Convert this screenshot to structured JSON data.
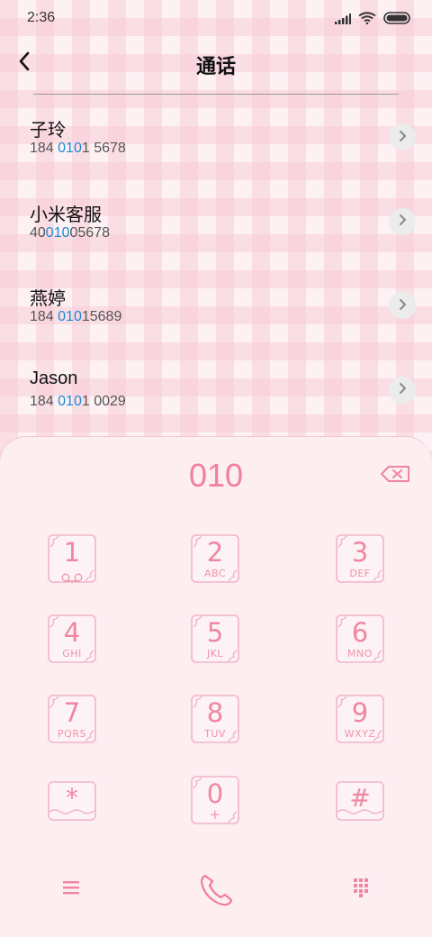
{
  "status_bar": {
    "time": "2:36",
    "icons": [
      "signal-icon",
      "wifi-icon",
      "battery-icon"
    ]
  },
  "header": {
    "title": "通话",
    "back_icon": "chevron-left-icon"
  },
  "contacts": [
    {
      "name": "子玲",
      "number_prefix": "184 ",
      "number_match": "010",
      "number_suffix": "1 5678"
    },
    {
      "name": "小米客服",
      "number_prefix": "40",
      "number_match": "010",
      "number_suffix": "05678"
    },
    {
      "name": "燕婷",
      "number_prefix": "184 ",
      "number_match": "010",
      "number_suffix": "15689"
    },
    {
      "name": "Jason",
      "number_prefix": "184 ",
      "number_match": "010",
      "number_suffix": "1 0029"
    }
  ],
  "dialer": {
    "input_value": "010",
    "keys": [
      {
        "digit": "1",
        "sub": ""
      },
      {
        "digit": "2",
        "sub": "ABC"
      },
      {
        "digit": "3",
        "sub": "DEF"
      },
      {
        "digit": "4",
        "sub": "GHI"
      },
      {
        "digit": "5",
        "sub": "JKL"
      },
      {
        "digit": "6",
        "sub": "MNO"
      },
      {
        "digit": "7",
        "sub": "PQRS"
      },
      {
        "digit": "8",
        "sub": "TUV"
      },
      {
        "digit": "9",
        "sub": "WXYZ"
      },
      {
        "digit": "*",
        "sub": ""
      },
      {
        "digit": "0",
        "sub": "+"
      },
      {
        "digit": "#",
        "sub": ""
      }
    ]
  },
  "colors": {
    "accent_pink": "#f07f9e",
    "match_blue": "#1b8bd8",
    "panel_bg": "#fdeef2"
  }
}
